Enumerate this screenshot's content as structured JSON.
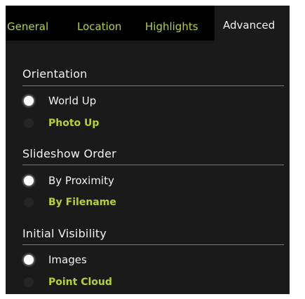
{
  "tabs": [
    {
      "label": "General",
      "active": false
    },
    {
      "label": "Location",
      "active": false
    },
    {
      "label": "Highlights",
      "active": false
    },
    {
      "label": "Advanced",
      "active": true
    }
  ],
  "colors": {
    "panel_bg": "#1a1a1a",
    "tabbar_bg": "#000000",
    "accent": "#b9d02e",
    "text": "#f2f2f2"
  },
  "sections": [
    {
      "title": "Orientation",
      "options": [
        {
          "label": "World Up",
          "selected": true
        },
        {
          "label": "Photo Up",
          "selected": false
        }
      ]
    },
    {
      "title": "Slideshow Order",
      "options": [
        {
          "label": "By Proximity",
          "selected": true
        },
        {
          "label": "By Filename",
          "selected": false
        }
      ]
    },
    {
      "title": "Initial Visibility",
      "options": [
        {
          "label": "Images",
          "selected": true
        },
        {
          "label": "Point Cloud",
          "selected": false
        }
      ]
    }
  ]
}
